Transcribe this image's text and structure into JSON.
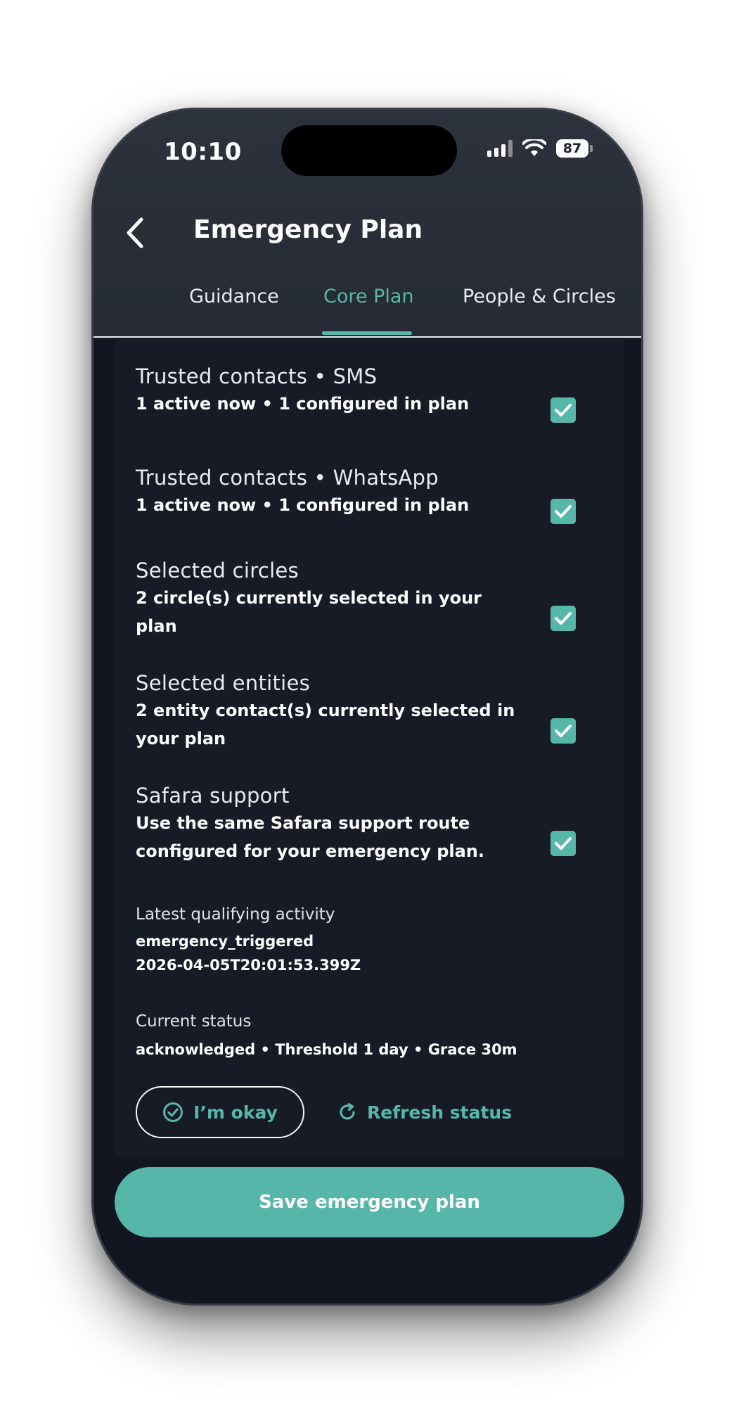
{
  "status_bar": {
    "time": "10:10",
    "battery": "87"
  },
  "header": {
    "title": "Emergency Plan"
  },
  "tabs": [
    {
      "label": "Guidance",
      "active": false
    },
    {
      "label": "Core Plan",
      "active": true
    },
    {
      "label": "People & Circles",
      "active": false
    }
  ],
  "channels": [
    {
      "title": "Trusted contacts • SMS",
      "subtitle": "1 active now • 1 configured in plan",
      "checked": true
    },
    {
      "title": "Trusted contacts • WhatsApp",
      "subtitle": "1 active now • 1 configured in plan",
      "checked": true
    },
    {
      "title": "Selected circles",
      "subtitle": "2 circle(s) currently selected in your plan",
      "checked": true
    },
    {
      "title": "Selected entities",
      "subtitle": "2 entity contact(s) currently selected in your plan",
      "checked": true
    },
    {
      "title": "Safara support",
      "subtitle": "Use the same Safara support route configured for your emergency plan.",
      "checked": true
    }
  ],
  "latest_activity": {
    "label": "Latest qualifying activity",
    "event": "emergency_triggered",
    "timestamp": "2026-04-05T20:01:53.399Z"
  },
  "current_status": {
    "label": "Current status",
    "value": "acknowledged • Threshold 1 day • Grace 30m"
  },
  "actions": {
    "okay_label": "I’m okay",
    "refresh_label": "Refresh status",
    "save_label": "Save emergency plan"
  },
  "colors": {
    "accent": "#56b7a8",
    "background": "#111620",
    "header": "#2d323c"
  },
  "icons": {
    "back": "chevron-left-icon",
    "okay": "check-circle-icon",
    "refresh": "refresh-icon",
    "checkbox": "checkbox-checked-icon"
  }
}
